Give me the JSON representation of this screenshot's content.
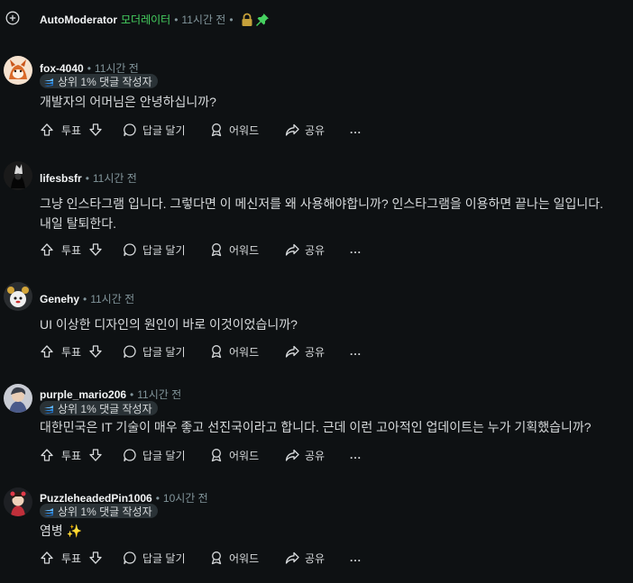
{
  "automod": {
    "author": "AutoModerator",
    "mod_label": "모더레이터",
    "time": "11시간 전"
  },
  "actions": {
    "vote": "투표",
    "reply": "답글 달기",
    "award": "어워드",
    "share": "공유",
    "more": "..."
  },
  "badge_label": "상위 1% 댓글 작성자",
  "comments": [
    {
      "author": "fox-4040",
      "time": "11시간 전",
      "text": "개발자의 어머님은 안녕하십니까?"
    },
    {
      "author": "lifesbsfr",
      "time": "11시간 전",
      "text": "그냥 인스타그램 입니다. 그렇다면 이 메신저를 왜 사용해야합니까? 인스타그램을 이용하면 끝나는 일입니다. 내일 탈퇴한다."
    },
    {
      "author": "Genehy",
      "time": "11시간 전",
      "text": "UI 이상한 디자인의 원인이 바로 이것이었습니까?"
    },
    {
      "author": "purple_mario206",
      "time": "11시간 전",
      "text": "대한민국은 IT 기술이 매우 좋고 선진국이라고 합니다. 근데 이런 고아적인 업데이트는 누가 기획했습니까?"
    },
    {
      "author": "PuzzleheadedPin1006",
      "time": "10시간 전",
      "text": "염병 ✨"
    }
  ]
}
